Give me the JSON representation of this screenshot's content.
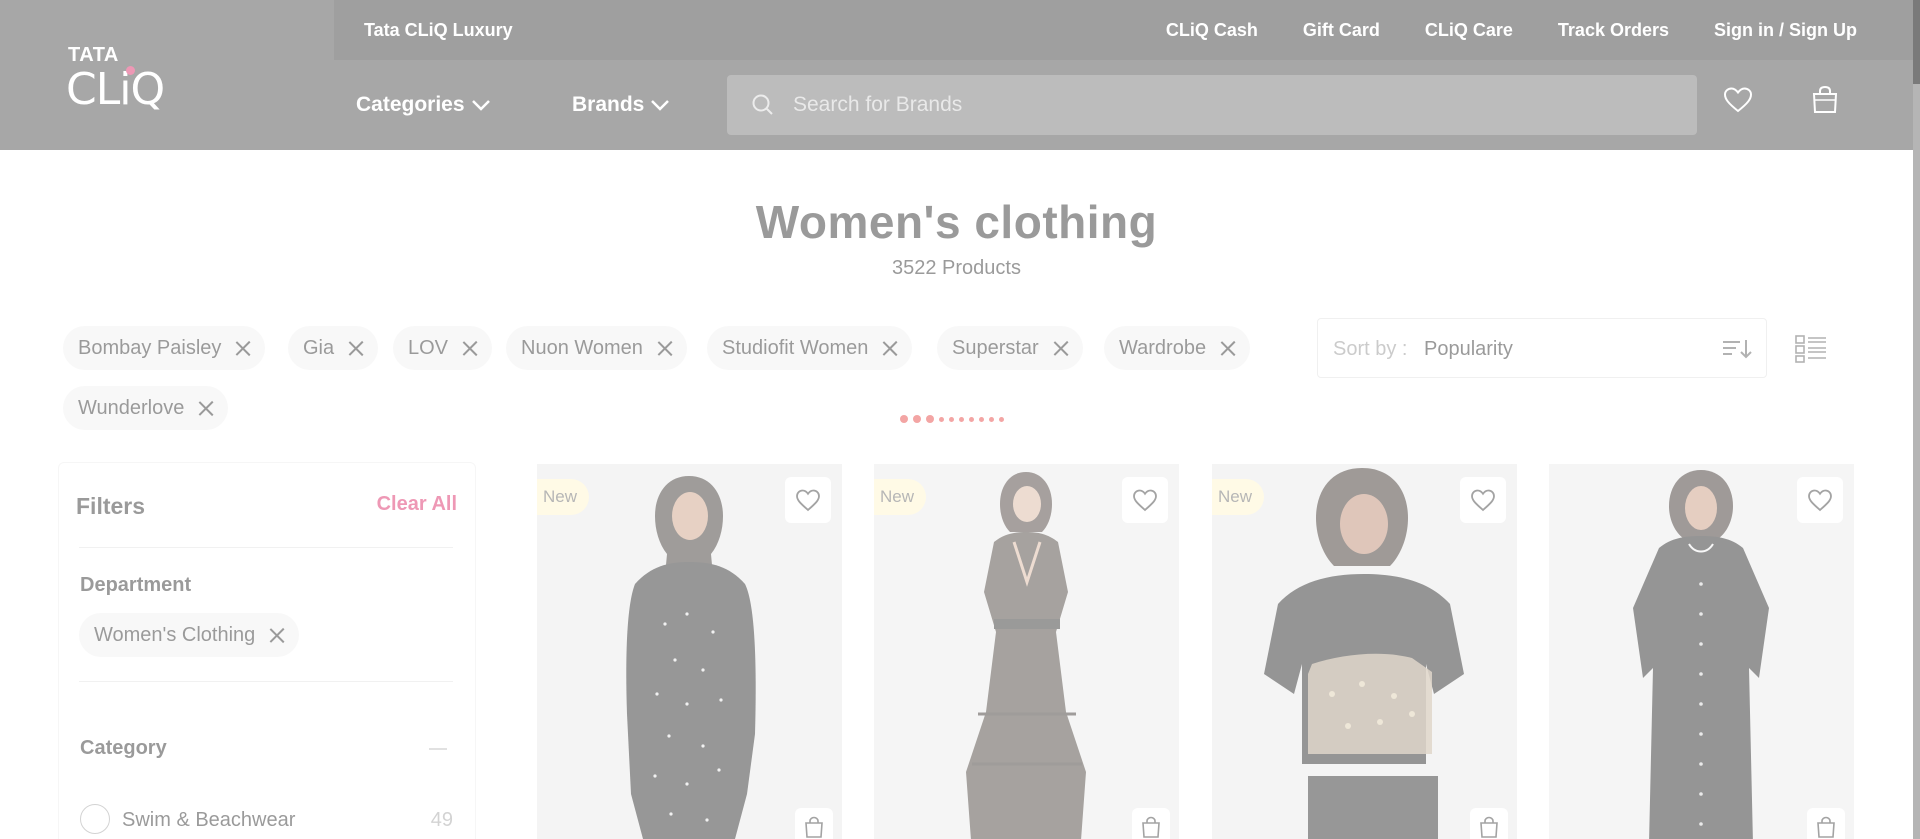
{
  "header": {
    "logo_top": "TATA",
    "logo_bottom": "CLiQ",
    "luxury_link": "Tata CLiQ Luxury",
    "top_links": [
      "CLiQ Cash",
      "Gift Card",
      "CLiQ Care",
      "Track Orders",
      "Sign in / Sign Up"
    ],
    "categories_label": "Categories",
    "brands_label": "Brands",
    "search_placeholder": "Search for Brands"
  },
  "page": {
    "title": "Women's clothing",
    "product_count": "3522 Products"
  },
  "applied_filters": [
    "Bombay Paisley",
    "Gia",
    "LOV",
    "Nuon Women",
    "Studiofit Women",
    "Superstar",
    "Wardrobe",
    "Wunderlove"
  ],
  "sort": {
    "label": "Sort by :",
    "value": "Popularity"
  },
  "filters_panel": {
    "title": "Filters",
    "clear_all": "Clear All",
    "department": {
      "heading": "Department",
      "selected": "Women's Clothing"
    },
    "category": {
      "heading": "Category",
      "options": [
        {
          "label": "Swim & Beachwear",
          "count": "49"
        }
      ]
    }
  },
  "products": [
    {
      "tag": "New",
      "garment_color": "#1a1a1a",
      "style": "dress-studded"
    },
    {
      "tag": "New",
      "garment_color": "#2a2320",
      "style": "wrap-dress"
    },
    {
      "tag": "New",
      "garment_color": "#111111",
      "style": "sequin-top"
    },
    {
      "tag": "",
      "garment_color": "#121212",
      "style": "shirt-dress"
    }
  ],
  "colors": {
    "header_bg": "#3d3d3d",
    "topbar_bg": "#2a2a2a",
    "accent": "#da1c5c",
    "new_tag": "#fff4c8",
    "loading_dot": "#e53935"
  }
}
